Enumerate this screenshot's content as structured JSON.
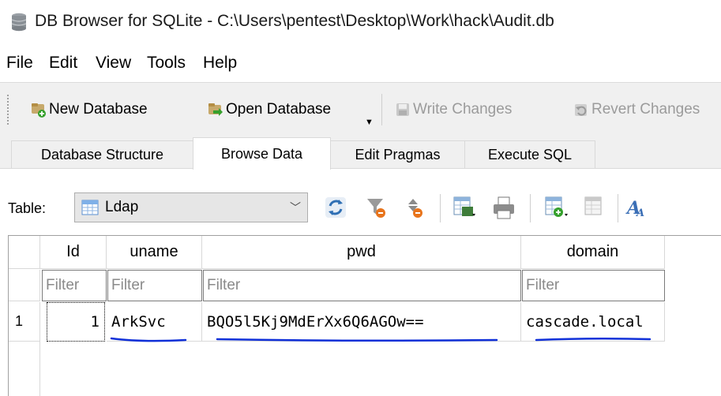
{
  "window": {
    "title": "DB Browser for SQLite - C:\\Users\\pentest\\Desktop\\Work\\hack\\Audit.db",
    "icon": "database-icon"
  },
  "menu": [
    "File",
    "Edit",
    "View",
    "Tools",
    "Help"
  ],
  "toolbar": {
    "new_database": "New Database",
    "open_database": "Open Database",
    "write_changes": "Write Changes",
    "revert_changes": "Revert Changes"
  },
  "tabs": [
    {
      "label": "Database Structure",
      "active": false
    },
    {
      "label": "Browse Data",
      "active": true
    },
    {
      "label": "Edit Pragmas",
      "active": false
    },
    {
      "label": "Execute SQL",
      "active": false
    }
  ],
  "browse": {
    "table_label": "Table:",
    "selected_table": "Ldap"
  },
  "grid": {
    "columns": [
      "Id",
      "uname",
      "pwd",
      "domain"
    ],
    "filter_placeholder": "Filter",
    "rows": [
      {
        "row_number": "1",
        "Id": "1",
        "uname": "ArkSvc",
        "pwd": "BQO5l5Kj9MdErXx6Q6AGOw==",
        "domain": "cascade.local"
      }
    ]
  },
  "colors": {
    "annotation_underline": "#1030d8",
    "toolbar_bg": "#f0f0f0"
  }
}
